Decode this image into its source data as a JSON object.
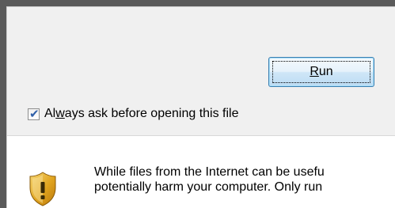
{
  "dialog": {
    "run_button": {
      "label_prefix": "",
      "label_mnemonic": "R",
      "label_rest": "un"
    },
    "always_ask": {
      "checked": true,
      "label_prefix": "Al",
      "label_mnemonic": "w",
      "label_rest": "ays ask before opening this file"
    },
    "warning": {
      "icon": "security-shield-warning-icon",
      "line1": "While files from the Internet can be usefu",
      "line2": "potentially harm your computer. Only run"
    }
  },
  "colors": {
    "dialog_background": "#f0f0f0",
    "button_border": "#3c7fb1",
    "check_color": "#2f5fa8",
    "shield_gold": "#e0a31e",
    "window_edge": "#5a5a5a"
  }
}
